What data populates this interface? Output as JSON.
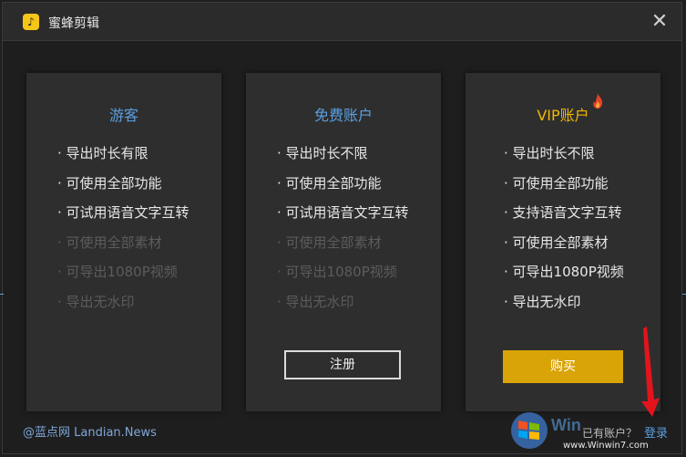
{
  "window": {
    "title": "蜜蜂剪辑",
    "close_symbol": "✕"
  },
  "cards": [
    {
      "title": "游客",
      "features": [
        {
          "text": "· 导出时长有限",
          "enabled": true
        },
        {
          "text": "· 可使用全部功能",
          "enabled": true
        },
        {
          "text": "· 可试用语音文字互转",
          "enabled": true
        },
        {
          "text": "· 可使用全部素材",
          "enabled": false
        },
        {
          "text": "· 可导出1080P视频",
          "enabled": false
        },
        {
          "text": "· 导出无水印",
          "enabled": false
        }
      ]
    },
    {
      "title": "免费账户",
      "features": [
        {
          "text": "· 导出时长不限",
          "enabled": true
        },
        {
          "text": "· 可使用全部功能",
          "enabled": true
        },
        {
          "text": "· 可试用语音文字互转",
          "enabled": true
        },
        {
          "text": "· 可使用全部素材",
          "enabled": false
        },
        {
          "text": "· 可导出1080P视频",
          "enabled": false
        },
        {
          "text": "· 导出无水印",
          "enabled": false
        }
      ],
      "button": "注册"
    },
    {
      "title": "VIP账户",
      "icon": "flame-icon",
      "features": [
        {
          "text": "· 导出时长不限",
          "enabled": true
        },
        {
          "text": "· 可使用全部功能",
          "enabled": true
        },
        {
          "text": "· 支持语音文字互转",
          "enabled": true
        },
        {
          "text": "· 可使用全部素材",
          "enabled": true
        },
        {
          "text": "· 可导出1080P视频",
          "enabled": true
        },
        {
          "text": "· 导出无水印",
          "enabled": true
        }
      ],
      "button": "购买"
    }
  ],
  "footer": {
    "watermark": "@蓝点网 Landian.News",
    "account_question": "已有账户？",
    "login": "登录"
  },
  "site_watermark": "www.Winwin7.com",
  "colors": {
    "accent_blue": "#5b9fe0",
    "vip_gold": "#f2b705",
    "buy_button": "#d9a407",
    "disabled_text": "#5c5c5c"
  }
}
